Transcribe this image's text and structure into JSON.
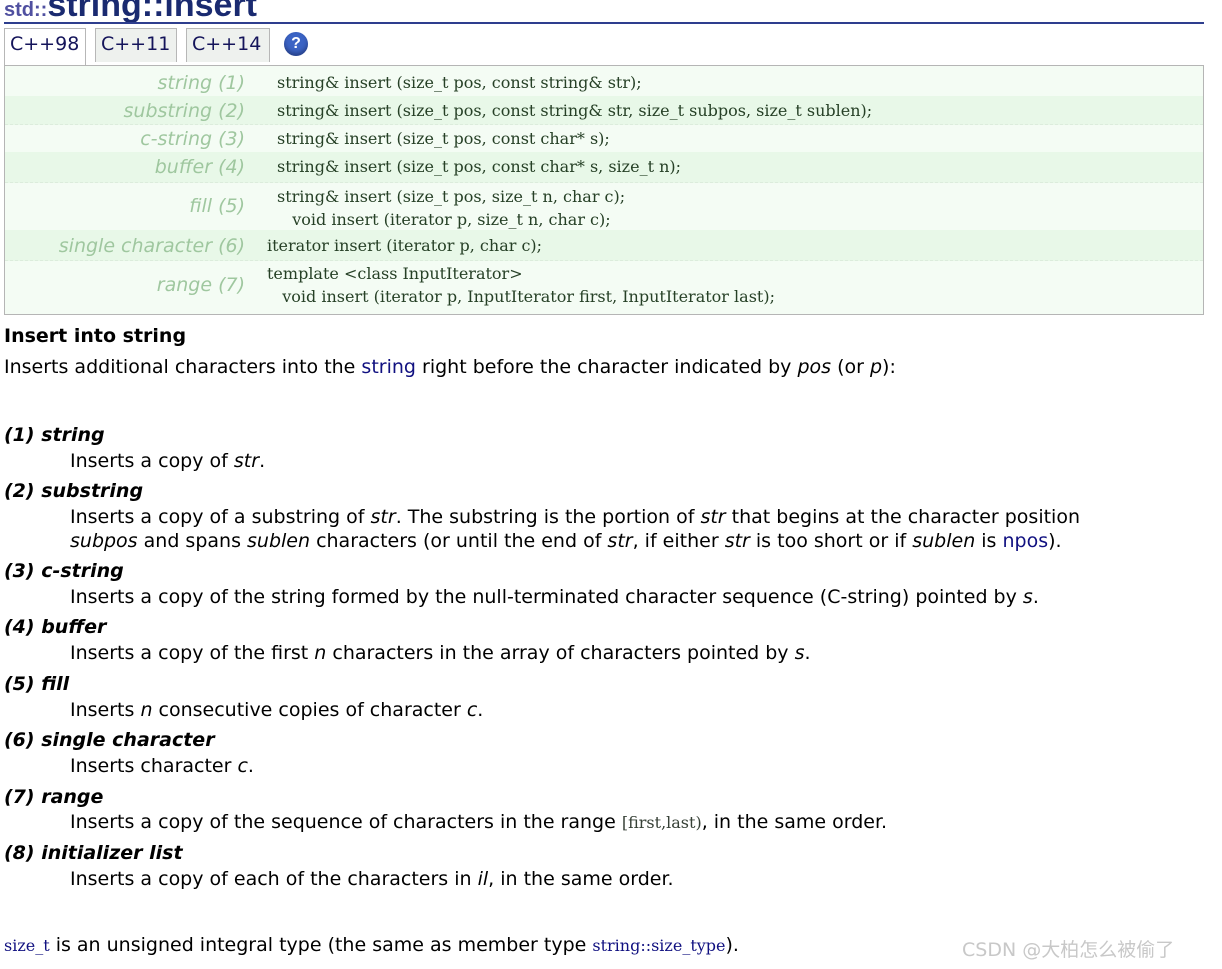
{
  "title": {
    "prefix": "std::",
    "main": "string::insert"
  },
  "tabs": [
    {
      "label": "C++98"
    },
    {
      "label": "C++11"
    },
    {
      "label": "C++14"
    }
  ],
  "help_icon": {
    "glyph": "?"
  },
  "prototypes": [
    {
      "label": "string (1)",
      "lines": [
        "string& insert (size_t pos, const string& str);"
      ]
    },
    {
      "label": "substring (2)",
      "lines": [
        "string& insert (size_t pos, const string& str, size_t subpos, size_t sublen);"
      ]
    },
    {
      "label": "c-string (3)",
      "lines": [
        "string& insert (size_t pos, const char* s);"
      ]
    },
    {
      "label": "buffer (4)",
      "lines": [
        "string& insert (size_t pos, const char* s, size_t n);"
      ]
    },
    {
      "label": "fill (5)",
      "lines": [
        "string& insert (size_t pos, size_t n, char c);",
        "   void insert (iterator p, size_t n, char c);"
      ]
    },
    {
      "label": "single character (6)",
      "lines": [
        "iterator insert (iterator p, char c);"
      ]
    },
    {
      "label": "range (7)",
      "lines": [
        "template <class InputIterator>",
        "   void insert (iterator p, InputIterator first, InputIterator last);"
      ]
    }
  ],
  "section_title": "Insert into string",
  "intro": {
    "before": "Inserts additional characters into the ",
    "link": "string",
    "middle": " right before the character indicated by ",
    "pos": "pos",
    "or": " (or ",
    "p": "p",
    "after": "):"
  },
  "descriptions": {
    "d1": {
      "head": "(1) string",
      "t1": "Inserts a copy of ",
      "i1": "str",
      "t2": "."
    },
    "d2": {
      "head": "(2) substring",
      "t1": "Inserts a copy of a substring of ",
      "i1": "str",
      "t2": ". The substring is the portion of ",
      "i2": "str",
      "t3": " that begins at the character position",
      "i3": "subpos",
      "t4": " and spans ",
      "i4": "sublen",
      "t5": " characters (or until the end of ",
      "i5": "str",
      "t6": ", if either ",
      "i6": "str",
      "t7": " is too short or if ",
      "i7": "sublen",
      "t8": " is ",
      "link": "npos",
      "t9": ")."
    },
    "d3": {
      "head": "(3) c-string",
      "t1": "Inserts a copy of the string formed by the null-terminated character sequence (C-string) pointed by ",
      "i1": "s",
      "t2": "."
    },
    "d4": {
      "head": "(4) buffer",
      "t1": "Inserts a copy of the first ",
      "i1": "n",
      "t2": " characters in the array of characters pointed by ",
      "i2": "s",
      "t3": "."
    },
    "d5": {
      "head": "(5) fill",
      "t1": "Inserts ",
      "i1": "n",
      "t2": " consecutive copies of character ",
      "i2": "c",
      "t3": "."
    },
    "d6": {
      "head": "(6) single character",
      "t1": "Inserts character ",
      "i1": "c",
      "t2": "."
    },
    "d7": {
      "head": "(7) range",
      "t1": "Inserts a copy of the sequence of characters in the range ",
      "code": "[first,last)",
      "t2": ", in the same order."
    },
    "d8": {
      "head": "(8) initializer list",
      "t1": "Inserts a copy of each of the characters in ",
      "i1": "il",
      "t2": ", in the same order."
    }
  },
  "footer": {
    "code1": "size_t",
    "t1": " is an unsigned integral type (the same as member type ",
    "code2": "string::size_type",
    "t2": ")."
  },
  "watermark": "CSDN @大柏怎么被偷了"
}
